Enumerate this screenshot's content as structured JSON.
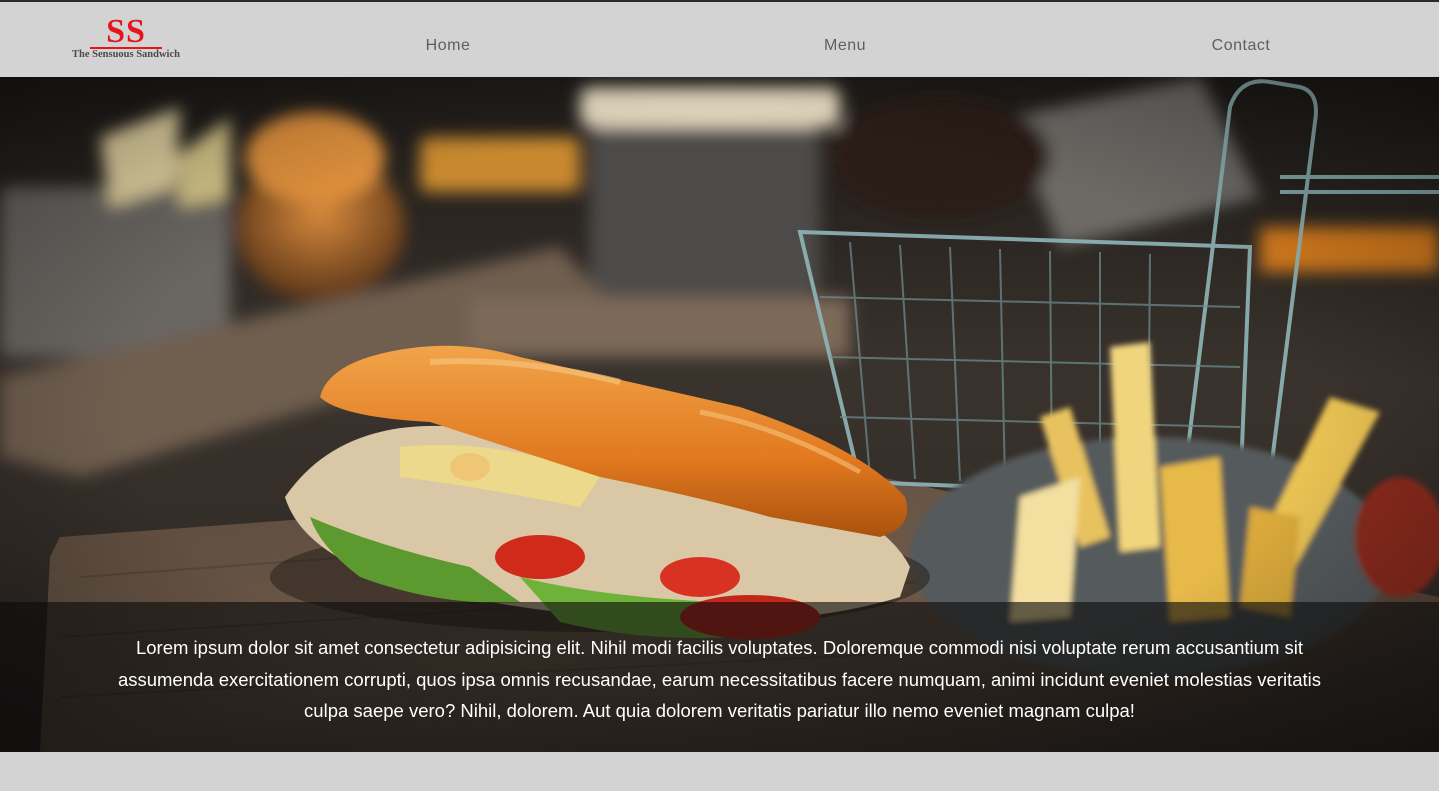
{
  "brand": {
    "logo_initials": "SS",
    "logo_name": "The Sensuous Sandwich",
    "accent_color": "#e8141b"
  },
  "nav": {
    "items": [
      {
        "label": "Home"
      },
      {
        "label": "Menu"
      },
      {
        "label": "Contact"
      }
    ]
  },
  "hero": {
    "image_subject": "photo",
    "caption": "Lorem ipsum dolor sit amet consectetur adipisicing elit. Nihil modi facilis voluptates. Doloremque commodi nisi voluptate rerum accusantium sit assumenda exercitationem corrupti, quos ipsa omnis recusandae, earum necessitatibus facere numquam, animi incidunt eveniet molestias veritatis culpa saepe vero? Nihil, dolorem. Aut quia dolorem veritatis pariatur illo nemo eveniet magnam culpa!"
  },
  "colors": {
    "navbar_bg": "#d3d3d3",
    "nav_text": "#5f5f5f",
    "caption_text": "#ffffff"
  }
}
